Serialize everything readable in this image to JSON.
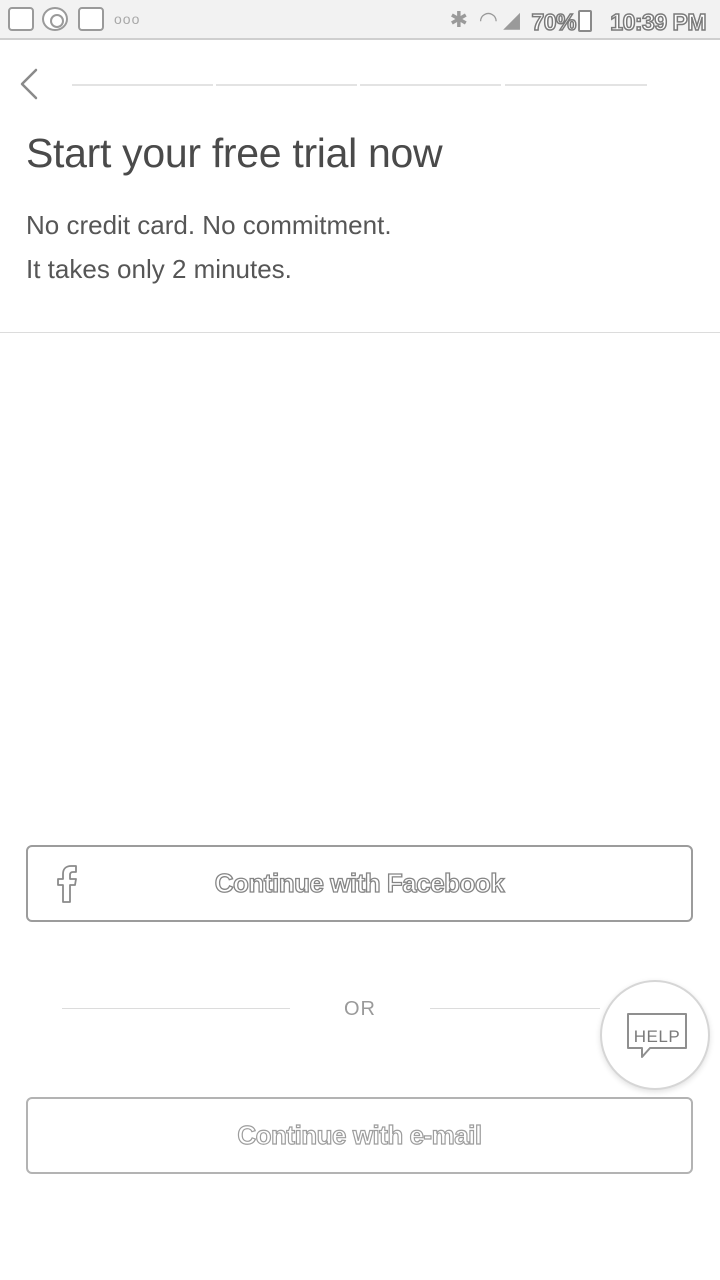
{
  "status_bar": {
    "notif_dots": "ooo",
    "battery_percent": "70%",
    "time": "10:39 PM",
    "icons": [
      "photo-icon",
      "camera-icon",
      "gmail-icon",
      "bluetooth-icon",
      "wifi-icon",
      "signal-icon",
      "battery-icon"
    ]
  },
  "header": {
    "back_icon": "chevron-left-icon",
    "progress_steps_total": 4,
    "progress_steps_completed": 0
  },
  "main": {
    "title": "Start your free trial now",
    "subtitle_line1": "No credit card. No commitment.",
    "subtitle_line2": "It takes only 2 minutes."
  },
  "actions": {
    "facebook_label": "Continue with Facebook",
    "facebook_icon": "facebook-icon",
    "or_label": "OR",
    "email_label": "Continue with e-mail"
  },
  "help": {
    "label": "HELP",
    "icon": "speech-bubble-icon"
  },
  "colors": {
    "text": "#4a4a4a",
    "border": "#9c9c9c",
    "divider": "#dcdcdc"
  }
}
